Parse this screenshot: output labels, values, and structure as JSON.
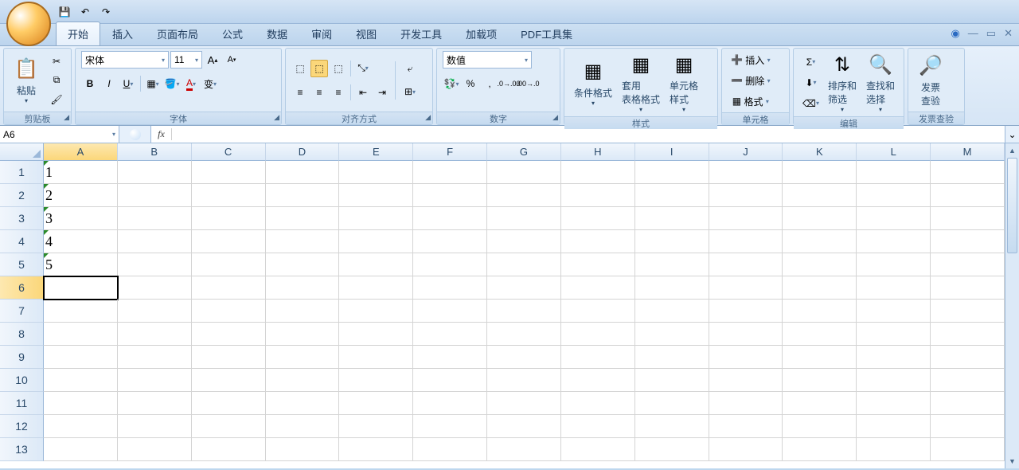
{
  "ribbon": {
    "tabs": [
      "开始",
      "插入",
      "页面布局",
      "公式",
      "数据",
      "审阅",
      "视图",
      "开发工具",
      "加载项",
      "PDF工具集"
    ],
    "active_tab": 0,
    "groups": {
      "clipboard": {
        "label": "剪贴板",
        "paste": "粘贴"
      },
      "font": {
        "label": "字体",
        "name": "宋体",
        "size": "11"
      },
      "alignment": {
        "label": "对齐方式"
      },
      "number": {
        "label": "数字",
        "format": "数值"
      },
      "styles": {
        "label": "样式",
        "cond_format": "条件格式",
        "table_format": "套用\n表格格式",
        "cell_styles": "单元格\n样式"
      },
      "cells": {
        "label": "单元格",
        "insert": "插入",
        "delete": "删除",
        "format": "格式"
      },
      "editing": {
        "label": "编辑",
        "sort_filter": "排序和\n筛选",
        "find_select": "查找和\n选择"
      },
      "invoice": {
        "label": "发票查验",
        "btn": "发票\n查验"
      }
    }
  },
  "namebox": "A6",
  "formula": "",
  "grid": {
    "columns": [
      "A",
      "B",
      "C",
      "D",
      "E",
      "F",
      "G",
      "H",
      "I",
      "J",
      "K",
      "L",
      "M"
    ],
    "rows": 13,
    "active_col": 0,
    "active_row": 5,
    "data": {
      "A1": "1",
      "A2": "2",
      "A3": "3",
      "A4": "4",
      "A5": "5"
    }
  }
}
